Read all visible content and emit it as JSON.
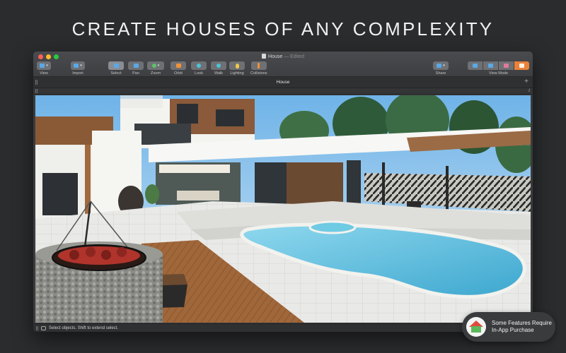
{
  "headline": "CREATE HOUSES OF ANY COMPLEXITY",
  "window": {
    "doc_title": "House",
    "doc_state": "— Edited",
    "tab_label": "House",
    "status_text": "Select objects. Shift to extend select."
  },
  "toolbar": {
    "view": "View",
    "import": "Import",
    "select": "Select",
    "pan": "Pan",
    "zoom": "Zoom",
    "orbit": "Orbit",
    "look": "Look",
    "walk": "Walk",
    "lighting": "Lighting",
    "collisions": "Collisions",
    "share": "Share",
    "view_mode": "View Mode"
  },
  "iap_badge": {
    "line1": "Some Features Require",
    "line2": "In-App Purchase"
  },
  "colors": {
    "accent_orange": "#e9823a",
    "pool": "#5fc0dd",
    "background": "#2b2c2e"
  }
}
